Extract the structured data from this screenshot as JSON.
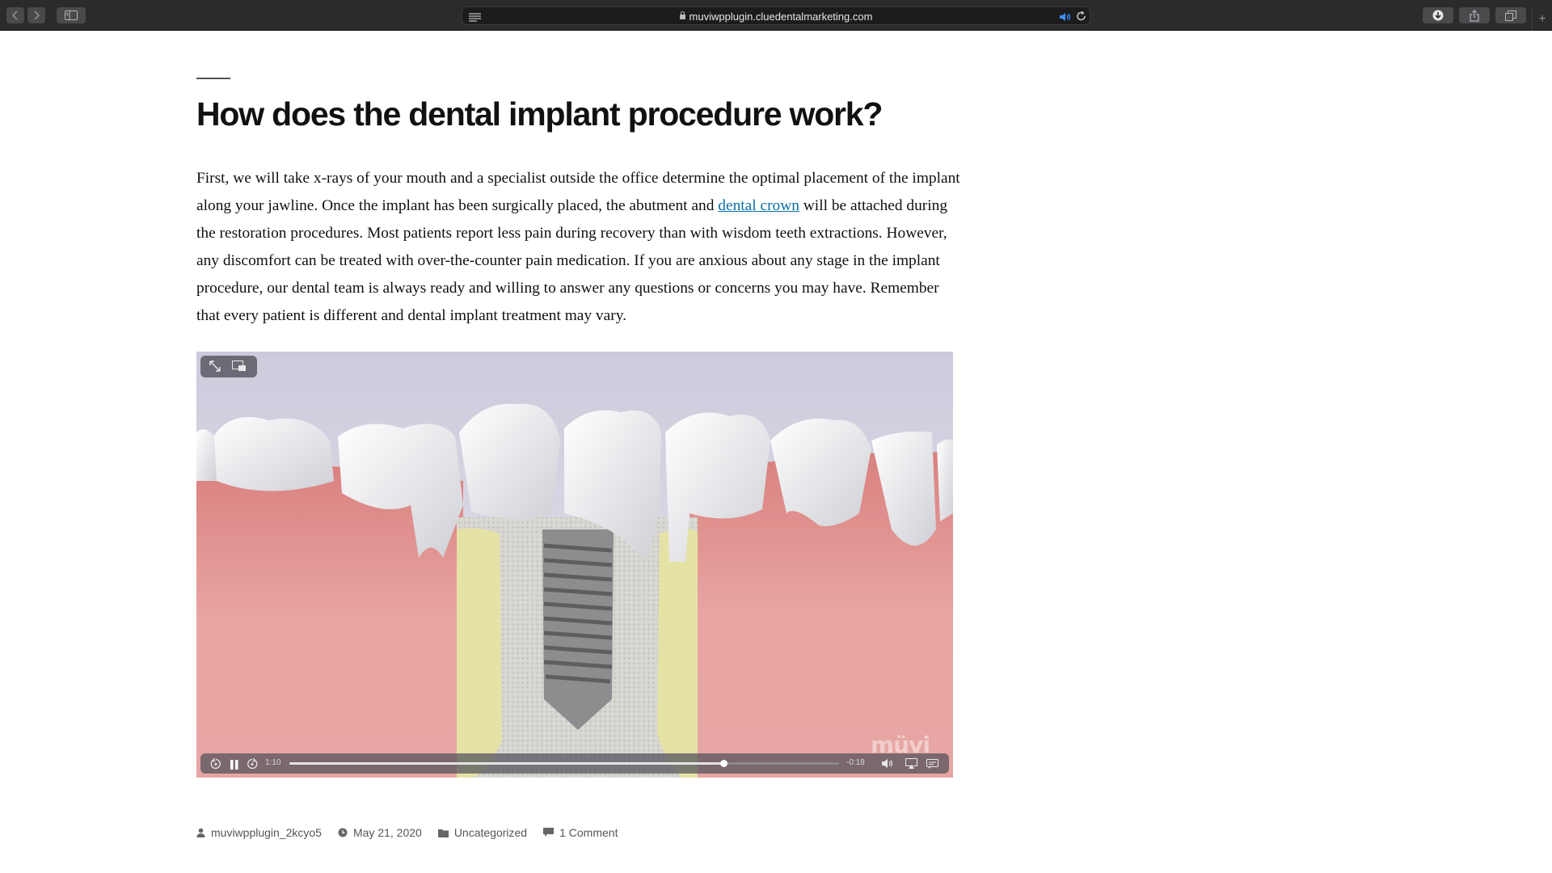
{
  "browser": {
    "url": "muviwpplugin.cluedentalmarketing.com",
    "new_tab_label": "+"
  },
  "article": {
    "title": "How does the dental implant procedure work?",
    "p_part1": "First, we will take x-rays of your mouth and a specialist outside the office determine the optimal placement of the implant along your jawline. Once the implant has been surgically placed, the abutment and ",
    "link_text": "dental crown",
    "p_part2": " will be attached during the restoration procedures. Most patients report less pain during recovery than with wisdom teeth extractions. However, any discomfort can be treated with over-the-counter pain medication. If you are anxious about any stage in the implant procedure, our dental team is always ready and willing to answer any questions or concerns you may have. Remember that every patient is different and dental implant treatment may vary."
  },
  "video": {
    "elapsed": "1:10",
    "remaining": "-0:18",
    "progress": 0.79,
    "watermark": "müvi"
  },
  "meta": {
    "author": "muviwpplugin_2kcyo5",
    "date": "May 21, 2020",
    "category": "Uncategorized",
    "comments": "1 Comment"
  },
  "colors": {
    "link": "#0d6ea6",
    "chrome_bg": "#2b2b2d",
    "accent_speaker": "#3a8cff"
  },
  "icons": [
    "back-icon",
    "forward-icon",
    "sidebar-icon",
    "reader-icon",
    "lock-icon",
    "speaker-icon",
    "reload-icon",
    "download-icon",
    "share-icon",
    "tabs-icon",
    "fullscreen-icon",
    "pip-icon",
    "skip-back-icon",
    "pause-icon",
    "skip-forward-icon",
    "volume-icon",
    "airplay-icon",
    "captions-icon",
    "person-icon",
    "clock-icon",
    "folder-icon",
    "comment-icon"
  ]
}
